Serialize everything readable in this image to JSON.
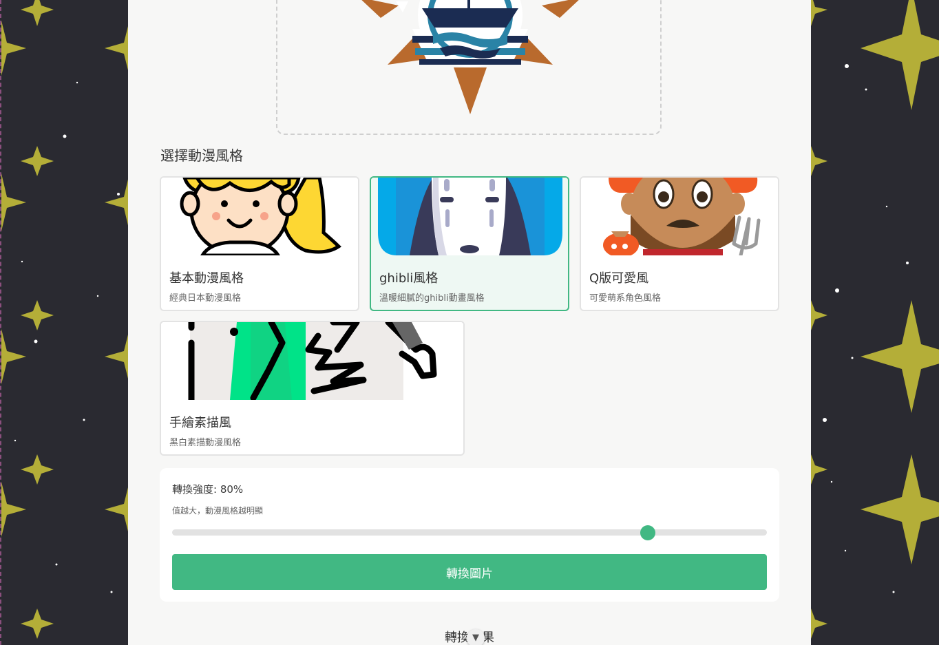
{
  "section_title": "選擇動漫風格",
  "styles": [
    {
      "name": "基本動漫風格",
      "desc": "經典日本動漫風格",
      "selected": false
    },
    {
      "name": "ghibli風格",
      "desc": "溫暖細膩的ghibli動畫風格",
      "selected": true
    },
    {
      "name": "Q版可愛風",
      "desc": "可愛萌系角色風格",
      "selected": false
    },
    {
      "name": "手繪素描風",
      "desc": "黑白素描動漫風格",
      "selected": false
    }
  ],
  "strength": {
    "label": "轉換強度: 80%",
    "hint": "值越大，動漫風格越明顯",
    "value": 0.8
  },
  "convert_button": "轉換圖片",
  "result_title": "轉換結果",
  "scroll_icon": "chevron-down-icon",
  "colors": {
    "accent": "#41b883",
    "background_side": "#2a2a31",
    "star": "#b7b23a"
  }
}
